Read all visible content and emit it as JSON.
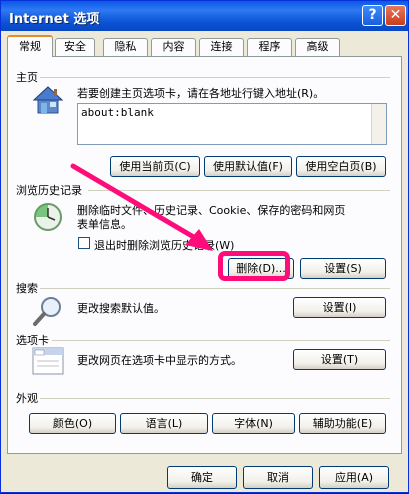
{
  "window": {
    "title": "Internet 选项",
    "help_glyph": "?",
    "close_glyph": "✕"
  },
  "tabs": [
    "常规",
    "安全",
    "隐私",
    "内容",
    "连接",
    "程序",
    "高级"
  ],
  "home_page": {
    "label": "主页",
    "description": "若要创建主页选项卡，请在各地址行键入地址(R)。",
    "address_value": "about:blank",
    "buttons": [
      "使用当前页(C)",
      "使用默认值(F)",
      "使用空白页(B)"
    ],
    "icon": "house-icon"
  },
  "browsing_history": {
    "label": "浏览历史记录",
    "description_line1": "删除临时文件、历史记录、Cookie、保存的密码和网页",
    "description_line2": "表单信息。",
    "checkbox_label": "退出时删除浏览历史记录(W)",
    "checkbox_checked": false,
    "delete_button": "删除(D)...",
    "settings_button": "设置(S)",
    "icon": "history-clock-icon"
  },
  "search": {
    "label": "搜索",
    "description": "更改搜索默认值。",
    "settings_button": "设置(I)",
    "icon": "magnifier-icon"
  },
  "tabs_section": {
    "label": "选项卡",
    "description": "更改网页在选项卡中显示的方式。",
    "settings_button": "设置(T)",
    "icon": "tabs-window-icon"
  },
  "appearance": {
    "label": "外观",
    "buttons": [
      "颜色(O)",
      "语言(L)",
      "字体(N)",
      "辅助功能(E)"
    ]
  },
  "dialog_buttons": {
    "ok": "确定",
    "cancel": "取消",
    "apply": "应用(A)"
  },
  "annotation": {
    "color": "#ff0c7a",
    "target": "删除(D)..."
  }
}
